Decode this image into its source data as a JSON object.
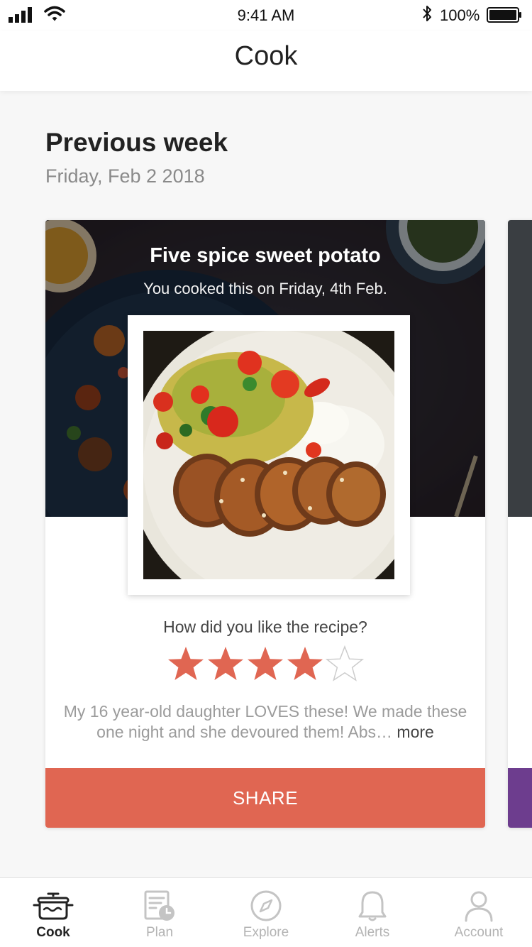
{
  "status_bar": {
    "time": "9:41 AM",
    "battery": "100%"
  },
  "nav": {
    "title": "Cook"
  },
  "section": {
    "title": "Previous week",
    "date": "Friday, Feb 2 2018"
  },
  "card": {
    "title": "Five spice sweet potato",
    "subtitle": "You cooked this on Friday, 4th Feb.",
    "rating_prompt": "How did you like the recipe?",
    "rating": 4,
    "rating_max": 5,
    "review_text": "My 16 year-old daughter LOVES these!  We made these one night and she devoured them! Abs…",
    "review_more": "more",
    "share_label": "SHARE",
    "colors": {
      "share": "#e06652",
      "star": "#e06652",
      "star_empty": "#cccccc"
    }
  },
  "peek_card": {
    "accent": "#6d3d8e"
  },
  "tabs": [
    {
      "label": "Cook",
      "icon": "pot-icon",
      "active": true
    },
    {
      "label": "Plan",
      "icon": "plan-icon",
      "active": false
    },
    {
      "label": "Explore",
      "icon": "compass-icon",
      "active": false
    },
    {
      "label": "Alerts",
      "icon": "bell-icon",
      "active": false
    },
    {
      "label": "Account",
      "icon": "person-icon",
      "active": false
    }
  ]
}
